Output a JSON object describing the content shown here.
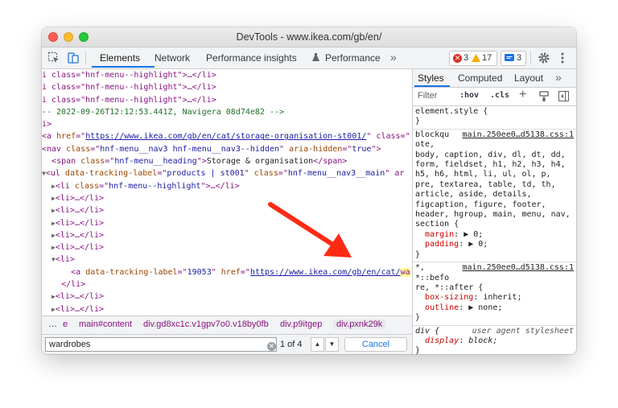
{
  "window": {
    "title": "DevTools - www.ikea.com/gb/en/"
  },
  "toolbar": {
    "tabs": [
      "Elements",
      "Network",
      "Performance insights",
      "Performance"
    ],
    "more": "»",
    "errors": "3",
    "warnings": "17",
    "messages": "3"
  },
  "code_lines": [
    {
      "indent": "",
      "parts": [
        {
          "t": "tag",
          "v": "i class=\"hnf-menu--highlight\">…</li>"
        }
      ]
    },
    {
      "indent": "",
      "parts": [
        {
          "t": "tag",
          "v": "i class=\"hnf-menu--highlight\">…</li>"
        }
      ]
    },
    {
      "indent": "",
      "parts": [
        {
          "t": "tag",
          "v": "i class=\"hnf-menu--highlight\">…</li>"
        }
      ]
    },
    {
      "indent": "",
      "parts": [
        {
          "t": "cmt",
          "v": "-- 2022-09-26T12:12:53.441Z, Navigera 08d74e82 -->"
        }
      ]
    },
    {
      "indent": "",
      "parts": [
        {
          "t": "tag",
          "v": "i>"
        }
      ]
    },
    {
      "indent": "",
      "parts": [
        {
          "t": "tag",
          "v": "<a "
        },
        {
          "t": "att",
          "v": "href"
        },
        {
          "t": "tag",
          "v": "=\""
        },
        {
          "t": "lnk",
          "v": "https://www.ikea.com/gb/en/cat/storage-organisation-st001/"
        },
        {
          "t": "tag",
          "v": "\" class=\""
        }
      ]
    },
    {
      "indent": "",
      "parts": [
        {
          "t": "tag",
          "v": "<nav "
        },
        {
          "t": "att",
          "v": "class"
        },
        {
          "t": "tag",
          "v": "=\""
        },
        {
          "t": "val",
          "v": "hnf-menu__nav3 hnf-menu__nav3--hidden"
        },
        {
          "t": "tag",
          "v": "\" "
        },
        {
          "t": "att",
          "v": "aria-hidden"
        },
        {
          "t": "tag",
          "v": "=\""
        },
        {
          "t": "val",
          "v": "true"
        },
        {
          "t": "tag",
          "v": "\">"
        }
      ]
    },
    {
      "indent": "  ",
      "parts": [
        {
          "t": "tag",
          "v": "<span "
        },
        {
          "t": "att",
          "v": "class"
        },
        {
          "t": "tag",
          "v": "=\""
        },
        {
          "t": "val",
          "v": "hnf-menu__heading"
        },
        {
          "t": "tag",
          "v": "\">"
        },
        {
          "t": "txt",
          "v": "Storage & organisation"
        },
        {
          "t": "tag",
          "v": "</span>"
        }
      ]
    },
    {
      "indent": "",
      "parts": [
        {
          "t": "tri",
          "v": "▼"
        },
        {
          "t": "tag",
          "v": "<ul "
        },
        {
          "t": "att",
          "v": "data-tracking-label"
        },
        {
          "t": "tag",
          "v": "=\""
        },
        {
          "t": "val",
          "v": "products | st001"
        },
        {
          "t": "tag",
          "v": "\" "
        },
        {
          "t": "att",
          "v": "class"
        },
        {
          "t": "tag",
          "v": "=\""
        },
        {
          "t": "val",
          "v": "hnf-menu__nav3__main"
        },
        {
          "t": "tag",
          "v": "\" ar"
        }
      ]
    },
    {
      "indent": "  ",
      "parts": [
        {
          "t": "tri",
          "v": "▶"
        },
        {
          "t": "tag",
          "v": "<li "
        },
        {
          "t": "att",
          "v": "class"
        },
        {
          "t": "tag",
          "v": "=\""
        },
        {
          "t": "val",
          "v": "hnf-menu--highlight"
        },
        {
          "t": "tag",
          "v": "\">…</li>"
        }
      ]
    },
    {
      "indent": "  ",
      "parts": [
        {
          "t": "tri",
          "v": "▶"
        },
        {
          "t": "tag",
          "v": "<li>…</li>"
        }
      ]
    },
    {
      "indent": "  ",
      "parts": [
        {
          "t": "tri",
          "v": "▶"
        },
        {
          "t": "tag",
          "v": "<li>…</li>"
        }
      ]
    },
    {
      "indent": "  ",
      "parts": [
        {
          "t": "tri",
          "v": "▶"
        },
        {
          "t": "tag",
          "v": "<li>…</li>"
        }
      ]
    },
    {
      "indent": "  ",
      "parts": [
        {
          "t": "tri",
          "v": "▶"
        },
        {
          "t": "tag",
          "v": "<li>…</li>"
        }
      ]
    },
    {
      "indent": "  ",
      "parts": [
        {
          "t": "tri",
          "v": "▶"
        },
        {
          "t": "tag",
          "v": "<li>…</li>"
        }
      ]
    },
    {
      "indent": "  ",
      "parts": [
        {
          "t": "tri",
          "v": "▼"
        },
        {
          "t": "tag",
          "v": "<li>"
        }
      ]
    },
    {
      "indent": "      ",
      "parts": [
        {
          "t": "tag",
          "v": "<a "
        },
        {
          "t": "att",
          "v": "data-tracking-label"
        },
        {
          "t": "tag",
          "v": "=\""
        },
        {
          "t": "val",
          "v": "19053"
        },
        {
          "t": "tag",
          "v": "\" "
        },
        {
          "t": "att",
          "v": "href"
        },
        {
          "t": "tag",
          "v": "=\""
        },
        {
          "t": "lnk",
          "v": "https://www.ikea.com/gb/en/cat/"
        },
        {
          "t": "hl",
          "v": "wa"
        }
      ]
    },
    {
      "indent": "    ",
      "parts": [
        {
          "t": "tag",
          "v": "</li>"
        }
      ]
    },
    {
      "indent": "  ",
      "parts": [
        {
          "t": "tri",
          "v": "▶"
        },
        {
          "t": "tag",
          "v": "<li>…</li>"
        }
      ]
    },
    {
      "indent": "  ",
      "parts": [
        {
          "t": "tri",
          "v": "▶"
        },
        {
          "t": "tag",
          "v": "<li>…</li>"
        }
      ]
    },
    {
      "indent": "  ",
      "parts": [
        {
          "t": "tri",
          "v": "▶"
        },
        {
          "t": "tag",
          "v": "<li>…</li>"
        }
      ]
    }
  ],
  "breadcrumbs": {
    "more": "…",
    "items": [
      "e",
      "main#content",
      "div.gd8xc1c.v1gpv7o0.v18by0fb",
      "div.p9itgep",
      "div.pxnk29k"
    ]
  },
  "search": {
    "value": "wardrobes",
    "count": "1 of 4",
    "cancel_label": "Cancel"
  },
  "styles_panel": {
    "tabs": [
      "Styles",
      "Computed",
      "Layout",
      "»"
    ],
    "filter_placeholder": "Filter",
    "hov": ":hov",
    "cls": ".cls",
    "rules": [
      {
        "selector": "element.style {",
        "source": "",
        "props": [],
        "close": "}"
      },
      {
        "selector": "blockqu\note,\nbody, caption, div, dl, dt, dd,\nform, fieldset, h1, h2, h3, h4,\nh5, h6, html, li, ul, ol, p,\npre, textarea, table, td, th,\narticle, aside, details,\nfigcaption, figure, footer,\nheader, hgroup, main, menu, nav,\nsection {",
        "source": "main.250ee0…d5138.css:1",
        "props": [
          {
            "name": "margin",
            "value": "▶ 0;"
          },
          {
            "name": "padding",
            "value": "▶ 0;"
          }
        ],
        "close": "}"
      },
      {
        "selector": "*,\n*::befo\nre, *::after {",
        "source": "main.250ee0…d5138.css:1",
        "props": [
          {
            "name": "box-sizing",
            "value": "inherit;"
          },
          {
            "name": "outline",
            "value": "▶ none;"
          }
        ],
        "close": "}"
      },
      {
        "selector": "div {",
        "source": "user agent stylesheet",
        "props": [
          {
            "name": "display",
            "value": "block;"
          }
        ],
        "close": "}"
      }
    ]
  },
  "colors": {
    "accent": "#1a73e8",
    "arrow": "#ff2a14",
    "error": "#d93025",
    "warning": "#f9ab00"
  }
}
